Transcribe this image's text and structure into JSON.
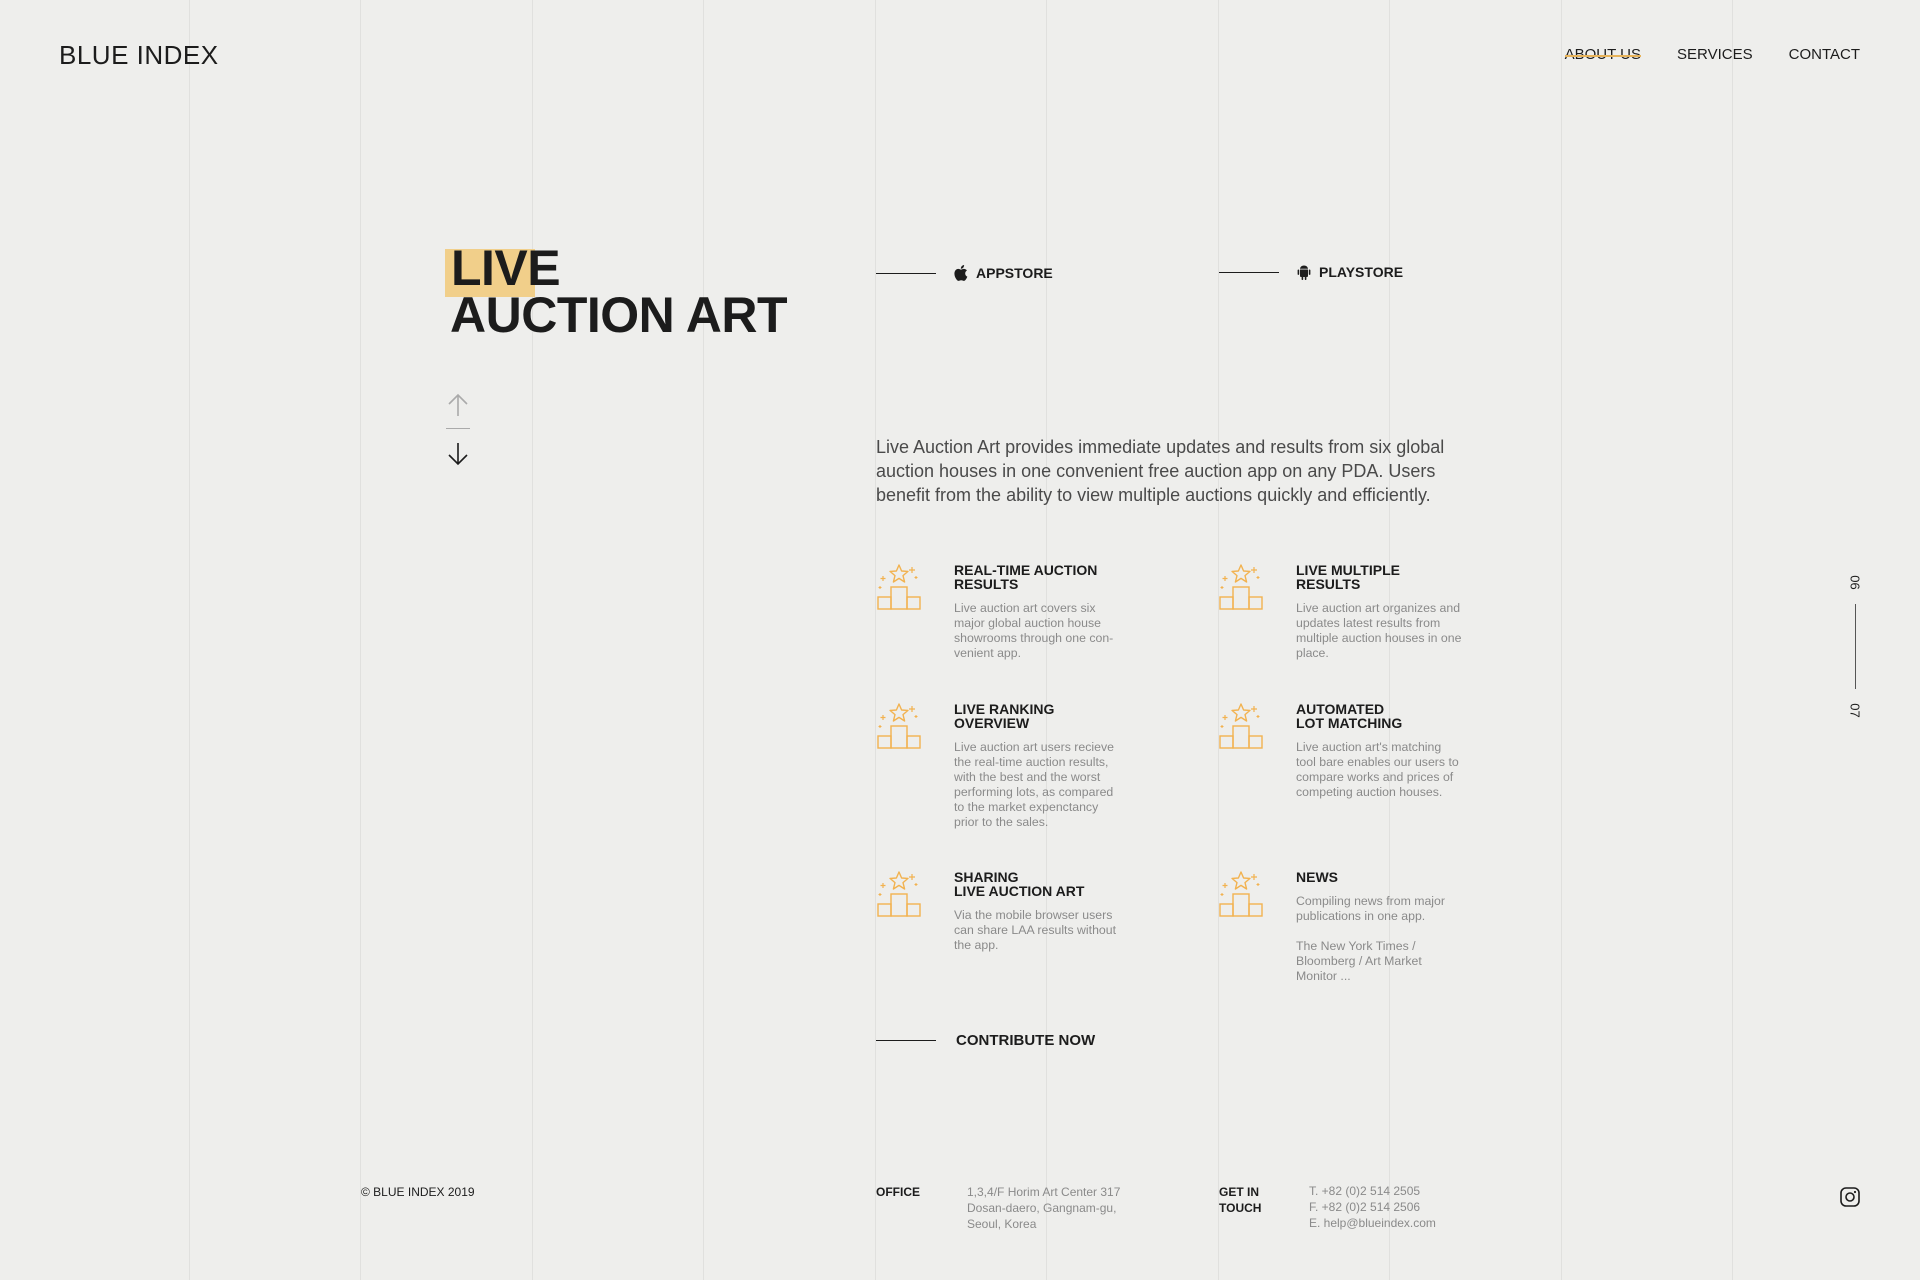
{
  "brand": {
    "logo_text": "BLUE INDEX"
  },
  "nav": {
    "items": [
      {
        "label": "ABOUT US",
        "active": true
      },
      {
        "label": "SERVICES",
        "active": false
      },
      {
        "label": "CONTACT",
        "active": false
      }
    ]
  },
  "hero": {
    "title_line1": "LIVE",
    "title_line2": "AUCTION ART",
    "highlight_color": "#f1cf8a"
  },
  "stores": {
    "appstore": "APPSTORE",
    "playstore": "PLAYSTORE"
  },
  "intro": "Live Auction Art provides immediate updates and results from six global auction houses in one convenient free auction app on any PDA. Users benefit from the ability to view multiple auctions quickly and efficiently.",
  "features": [
    {
      "title": "REAL-TIME AUCTION\nRESULTS",
      "desc": "Live auction art covers six\nmajor global auction house\nshowrooms through one con-\nvenient app.",
      "icon": "podium-star-icon"
    },
    {
      "title": "LIVE MULTIPLE\nRESULTS",
      "desc": "Live auction art organizes and\nupdates latest results from\nmultiple auction houses in one\nplace.",
      "icon": "podium-star-icon"
    },
    {
      "title": "LIVE RANKING\nOVERVIEW",
      "desc": "Live auction art users recieve\nthe real-time auction results,\nwith the best and the worst\nperforming lots, as compared\nto the market expenctancy\nprior to the sales.",
      "icon": "podium-star-icon"
    },
    {
      "title": "AUTOMATED\nLOT MATCHING",
      "desc": "Live auction art's matching\ntool bare enables our users to\ncompare works and prices of\ncompeting auction houses.",
      "icon": "podium-star-icon"
    },
    {
      "title": "SHARING\nLIVE AUCTION ART",
      "desc": "Via the mobile browser users\ncan share LAA results without\nthe app.",
      "icon": "podium-star-icon"
    },
    {
      "title": "NEWS",
      "desc": "Compiling news from major\npublications in one app.",
      "extra": "The New York Times  /\nBloomberg  /  Art Market\nMonitor ...",
      "icon": "podium-star-icon"
    }
  ],
  "contribute": "CONTRIBUTE NOW",
  "pager": {
    "current": "06",
    "next": "07"
  },
  "footer": {
    "copyright": "© BLUE INDEX 2019",
    "office_label": "OFFICE",
    "office_address": "1,3,4/F Horim Art Center 317\nDosan-daero, Gangnam-gu,\nSeoul, Korea",
    "contact_label": "GET IN\nTOUCH",
    "contact_info": "T. +82 (0)2 514 2505\nF. +82 (0)2 514 2506\nE. help@blueindex.com"
  },
  "colors": {
    "accent": "#e7b35a",
    "icon": "#f2b24f",
    "background": "#eeeeec"
  }
}
